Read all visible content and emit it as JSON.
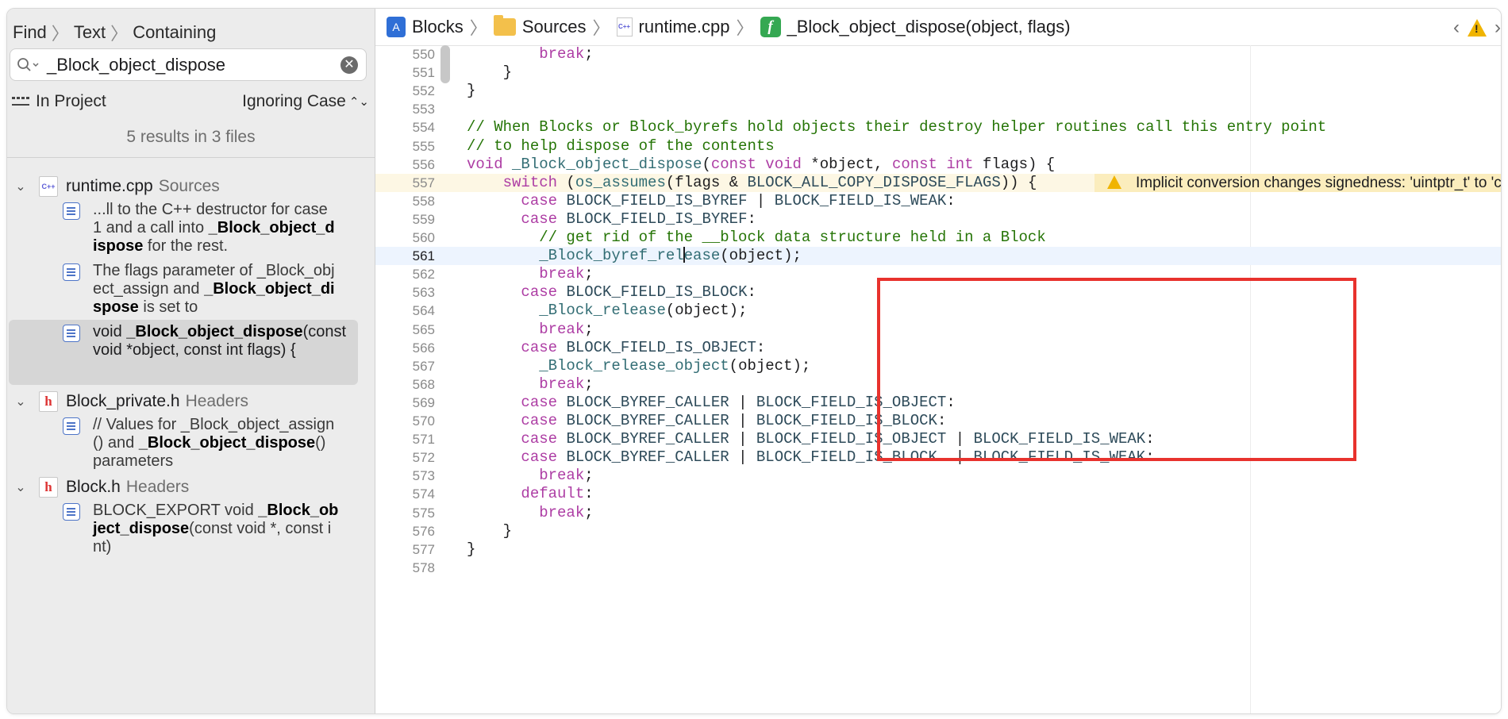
{
  "find": {
    "crumbs": [
      "Find",
      "Text",
      "Containing"
    ],
    "query": "_Block_object_dispose",
    "scope": "In Project",
    "case_mode": "Ignoring Case",
    "results_summary": "5 results in 3 files"
  },
  "files": [
    {
      "name": "runtime.cpp",
      "group": "Sources"
    },
    {
      "name": "Block_private.h",
      "group": "Headers"
    },
    {
      "name": "Block.h",
      "group": "Headers"
    }
  ],
  "matches": [
    {
      "pre": "...ll to the C++ destructor for case 1 and a call into ",
      "bold": "_Block_object_dispose",
      "post": " for the rest."
    },
    {
      "pre": "The flags parameter of _Block_object_assign and ",
      "bold": "_Block_object_dispose",
      "post": " is set to"
    },
    {
      "pre": "void ",
      "bold": "_Block_object_dispose",
      "post": "(const void *object, const int flags) {"
    },
    {
      "pre": "// Values for _Block_object_assign() and ",
      "bold": "_Block_object_dispose",
      "post": "() parameters"
    },
    {
      "pre": "BLOCK_EXPORT void ",
      "bold": "_Block_object_dispose",
      "post": "(const void *, const int)"
    }
  ],
  "jumpbar": {
    "project": "Blocks",
    "folder": "Sources",
    "file": "runtime.cpp",
    "symbol": "_Block_object_dispose(object, flags)"
  },
  "warning": "Implicit conversion changes signedness: 'uintptr_t' to 'const int'",
  "code_lines": [
    {
      "n": "550",
      "t": "        break;"
    },
    {
      "n": "551",
      "t": "    }"
    },
    {
      "n": "552",
      "t": "}"
    },
    {
      "n": "553",
      "t": ""
    },
    {
      "n": "554",
      "t": "// When Blocks or Block_byrefs hold objects their destroy helper routines call this entry point"
    },
    {
      "n": "555",
      "t": "// to help dispose of the contents"
    },
    {
      "n": "556",
      "t": "void _Block_object_dispose(const void *object, const int flags) {"
    },
    {
      "n": "557",
      "t": "    switch (os_assumes(flags & BLOCK_ALL_COPY_DISPOSE_FLAGS)) {"
    },
    {
      "n": "558",
      "t": "      case BLOCK_FIELD_IS_BYREF | BLOCK_FIELD_IS_WEAK:"
    },
    {
      "n": "559",
      "t": "      case BLOCK_FIELD_IS_BYREF:"
    },
    {
      "n": "560",
      "t": "        // get rid of the __block data structure held in a Block"
    },
    {
      "n": "561",
      "t": "        _Block_byref_release(object);"
    },
    {
      "n": "562",
      "t": "        break;"
    },
    {
      "n": "563",
      "t": "      case BLOCK_FIELD_IS_BLOCK:"
    },
    {
      "n": "564",
      "t": "        _Block_release(object);"
    },
    {
      "n": "565",
      "t": "        break;"
    },
    {
      "n": "566",
      "t": "      case BLOCK_FIELD_IS_OBJECT:"
    },
    {
      "n": "567",
      "t": "        _Block_release_object(object);"
    },
    {
      "n": "568",
      "t": "        break;"
    },
    {
      "n": "569",
      "t": "      case BLOCK_BYREF_CALLER | BLOCK_FIELD_IS_OBJECT:"
    },
    {
      "n": "570",
      "t": "      case BLOCK_BYREF_CALLER | BLOCK_FIELD_IS_BLOCK:"
    },
    {
      "n": "571",
      "t": "      case BLOCK_BYREF_CALLER | BLOCK_FIELD_IS_OBJECT | BLOCK_FIELD_IS_WEAK:"
    },
    {
      "n": "572",
      "t": "      case BLOCK_BYREF_CALLER | BLOCK_FIELD_IS_BLOCK  | BLOCK_FIELD_IS_WEAK:"
    },
    {
      "n": "573",
      "t": "        break;"
    },
    {
      "n": "574",
      "t": "      default:"
    },
    {
      "n": "575",
      "t": "        break;"
    },
    {
      "n": "576",
      "t": "    }"
    },
    {
      "n": "577",
      "t": "}"
    },
    {
      "n": "578",
      "t": ""
    }
  ],
  "current_line": "561",
  "warning_line": "557",
  "colors": {
    "keyword": "#ad3da4",
    "comment": "#267507",
    "function": "#326d74",
    "highlight_box": "#e8322d",
    "warning": "#f0b400"
  },
  "icons": [
    "magnifier-icon",
    "clear-icon",
    "scope-icon",
    "chevron-down-icon",
    "cpp-file-icon",
    "header-file-icon",
    "match-icon",
    "project-icon",
    "folder-icon",
    "function-icon",
    "back-icon",
    "warning-icon",
    "forward-icon"
  ]
}
